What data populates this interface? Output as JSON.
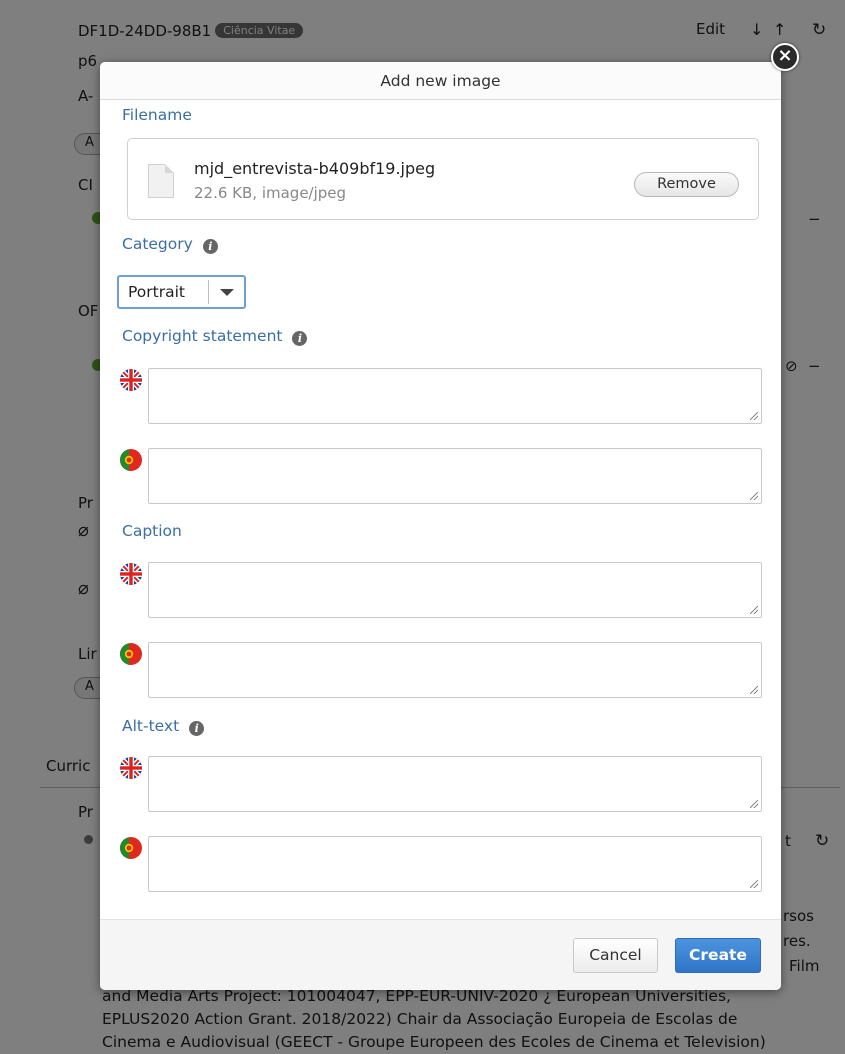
{
  "background": {
    "row1_id": "DF1D-24DD-98B1",
    "row1_badge": "Ciência Vitae",
    "row1_actions": "Edit",
    "row2_id": "p6",
    "row3_id": "A-",
    "sec_ci": "CI",
    "sec_or": "OF",
    "sec_pr": "Pr",
    "sec_li": "Lir",
    "pill_a": "A",
    "curric": "Curric",
    "pr2": "Pr",
    "right_t": "t",
    "right_frag1": "rsos",
    "right_frag2": "res.",
    "right_frag3": "Film",
    "para_line1": "and Media Arts Project: 101004047, EPP-EUR-UNIV-2020 ¿ European Universities,",
    "para_line2": "EPLUS2020 Action Grant. 2018/2022) Chair da Associação Europeia de Escolas de",
    "para_line3": "Cinema e Audiovisual (GEECT - Groupe Europeen des Ecoles de Cinema et Television)"
  },
  "modal": {
    "title": "Add new image",
    "close_symbol": "×",
    "filename_label": "Filename",
    "file": {
      "name": "mjd_entrevista-b409bf19.jpeg",
      "meta": "22.6 KB, image/jpeg",
      "remove_label": "Remove"
    },
    "category_label": "Category",
    "category_value": "Portrait",
    "copyright_label": "Copyright statement",
    "caption_label": "Caption",
    "alttext_label": "Alt-text",
    "info_symbol": "i",
    "cancel_label": "Cancel",
    "create_label": "Create"
  },
  "icons": {
    "flag_en": "uk-flag-icon",
    "flag_pt": "portugal-flag-icon",
    "info": "info-icon",
    "file": "file-icon",
    "close": "close-icon"
  },
  "colors": {
    "label_blue": "#3a6fa3",
    "primary_button": "#2f74c6",
    "select_focus": "#6d9fd3"
  }
}
